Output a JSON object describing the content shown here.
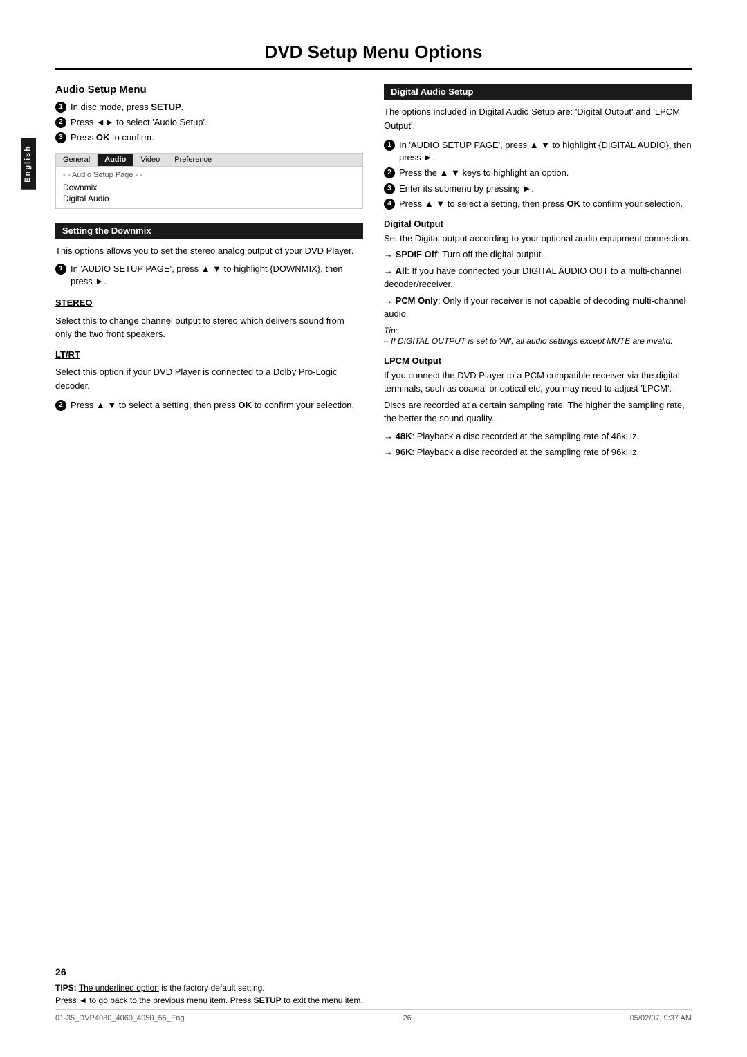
{
  "page": {
    "title": "DVD Setup Menu Options",
    "number": "26",
    "english_tab": "English"
  },
  "tips_footer": {
    "label": "TIPS:",
    "text1": "The underlined option is the factory default setting.",
    "text2": "Press ◄ to go back to the previous menu item. Press SETUP to exit the menu item."
  },
  "footer_meta": {
    "left": "01-35_DVP4080_4060_4050_55_Eng",
    "center": "26",
    "right": "05/02/07, 9:37 AM"
  },
  "left_column": {
    "audio_setup_menu": {
      "heading": "Audio Setup Menu",
      "steps": [
        {
          "num": "1",
          "text": "In disc mode, press ",
          "bold": "SETUP",
          "suffix": "."
        },
        {
          "num": "2",
          "text": "Press ◄► to select 'Audio Setup'."
        },
        {
          "num": "3",
          "text": "Press ",
          "bold": "OK",
          "suffix": " to confirm."
        }
      ],
      "menu_box": {
        "tabs": [
          "General",
          "Audio",
          "Video",
          "Preference"
        ],
        "active_tab": "Audio",
        "subtitle": "- - Audio Setup Page - -",
        "items": [
          "Downmix",
          "Digital Audio"
        ]
      }
    },
    "setting_downmix": {
      "heading": "Setting the Downmix",
      "intro": "This options allows you to set the stereo analog output of your DVD Player.",
      "step1": "In 'AUDIO SETUP PAGE', press ▲ ▼ to highlight {DOWNMIX}, then press ►.",
      "stereo": {
        "title": "STEREO",
        "text": "Select this to change channel output to stereo which delivers sound from only the two front speakers."
      },
      "ltrt": {
        "title": "LT/RT",
        "text": "Select this option if your DVD Player is connected to a Dolby Pro-Logic decoder."
      },
      "step2": "Press ▲ ▼ to select a setting, then press OK to confirm your selection."
    }
  },
  "right_column": {
    "digital_audio_setup": {
      "heading": "Digital Audio Setup",
      "intro": "The options included in Digital Audio Setup are: 'Digital Output' and 'LPCM Output'.",
      "steps": [
        {
          "num": "1",
          "text": "In 'AUDIO SETUP PAGE', press ▲ ▼ to highlight {DIGITAL AUDIO}, then press ►."
        },
        {
          "num": "2",
          "text": "Press the ▲ ▼ keys to highlight an option."
        },
        {
          "num": "3",
          "text": "Enter its submenu by pressing ►."
        },
        {
          "num": "4",
          "text": "Press ▲ ▼ to select a setting, then press OK to confirm your selection."
        }
      ],
      "digital_output": {
        "title": "Digital Output",
        "intro": "Set the Digital output according to your optional audio equipment connection.",
        "spdif": {
          "label": "SPDIF Off",
          "text": ": Turn off the digital output."
        },
        "all": {
          "label": "All",
          "text": ": If you have connected your DIGITAL AUDIO OUT to a multi-channel decoder/receiver."
        },
        "pcm": {
          "label": "PCM Only",
          "text": ": Only if your receiver is not capable of decoding multi-channel audio."
        },
        "tip_label": "Tip:",
        "tip_text": "– If DIGITAL OUTPUT is set to 'All', all audio settings except MUTE are invalid."
      },
      "lpcm_output": {
        "title": "LPCM Output",
        "intro": "If you connect the DVD Player to a PCM compatible receiver via the digital terminals, such as coaxial or optical etc, you may need to adjust 'LPCM'.",
        "text2": "Discs are recorded at a certain sampling rate. The higher the sampling rate, the better the sound quality.",
        "48k": {
          "label": "48K",
          "text": ": Playback a disc recorded at the sampling rate of 48kHz."
        },
        "96k": {
          "label": "96K",
          "text": ": Playback a disc recorded at the sampling rate of 96kHz."
        }
      }
    }
  }
}
